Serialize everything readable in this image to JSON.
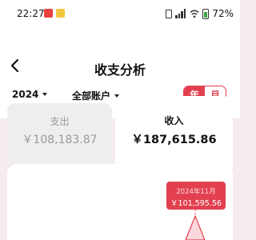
{
  "status_bar": {
    "time": "22:27",
    "battery_percent": "72%",
    "icons": [
      "notification-app-icon",
      "notification-app-icon-2",
      "sim-icon",
      "signal-icon",
      "wifi-icon",
      "battery-icon"
    ]
  },
  "header": {
    "title": "收支分析",
    "back_icon": "back-arrow-icon"
  },
  "filters": {
    "year": "2024",
    "account": "全部账户"
  },
  "period_toggle": {
    "year_label": "年",
    "month_label": "月",
    "selected": "年"
  },
  "summary_tabs": {
    "expense": {
      "label": "支出",
      "value": "￥108,183.87"
    },
    "income": {
      "label": "收入",
      "value": "￥187,615.86",
      "selected": true
    }
  },
  "chart": {
    "tooltip_month": "2024年11月",
    "tooltip_amount": "￥101,595.56"
  },
  "colors": {
    "accent": "#e2404f",
    "page_bg": "#f6ecef",
    "muted_text": "#9a9a9a"
  }
}
